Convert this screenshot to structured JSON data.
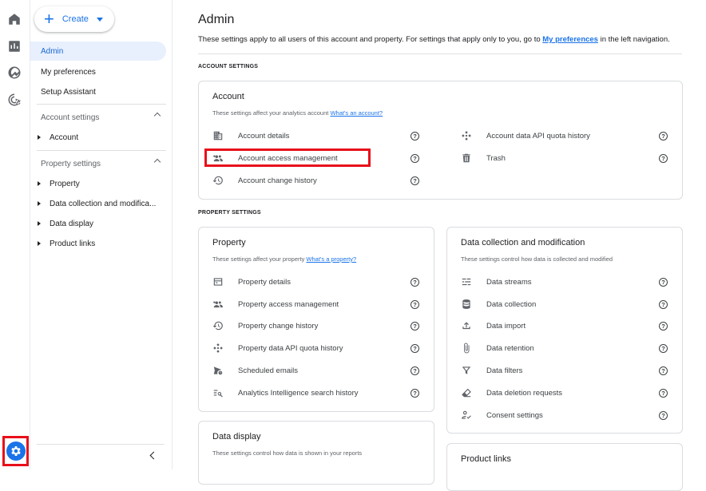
{
  "rail": {
    "icons": [
      "home-icon",
      "reports-icon",
      "explore-icon",
      "advertising-icon"
    ],
    "admin_icon": "gear-icon"
  },
  "nav": {
    "create_label": "Create",
    "items": {
      "admin": "Admin",
      "preferences": "My preferences",
      "setup": "Setup Assistant"
    },
    "account_settings": {
      "label": "Account settings",
      "items": [
        "Account"
      ]
    },
    "property_settings": {
      "label": "Property settings",
      "items": [
        "Property",
        "Data collection and modifica...",
        "Data display",
        "Product links"
      ]
    }
  },
  "main": {
    "title": "Admin",
    "subtitle_before": "These settings apply to all users of this account and property. For settings that apply only to you, go to ",
    "subtitle_link": "My preferences",
    "subtitle_after": " in the left navigation.",
    "account_section_label": "ACCOUNT SETTINGS",
    "property_section_label": "PROPERTY SETTINGS"
  },
  "account_card": {
    "title": "Account",
    "subtitle": "These settings affect your analytics account ",
    "subtitle_link": "What's an account?",
    "left_items": [
      "Account details",
      "Account access management",
      "Account change history"
    ],
    "right_items": [
      "Account data API quota history",
      "Trash"
    ]
  },
  "property_card": {
    "title": "Property",
    "subtitle": "These settings affect your property ",
    "subtitle_link": "What's a property?",
    "items": [
      "Property details",
      "Property access management",
      "Property change history",
      "Property data API quota history",
      "Scheduled emails",
      "Analytics Intelligence search history"
    ]
  },
  "data_collection_card": {
    "title": "Data collection and modification",
    "subtitle": "These settings control how data is collected and modified",
    "items": [
      "Data streams",
      "Data collection",
      "Data import",
      "Data retention",
      "Data filters",
      "Data deletion requests",
      "Consent settings"
    ]
  },
  "data_display_card": {
    "title": "Data display",
    "subtitle": "These settings control how data is shown in your reports"
  },
  "product_links_card": {
    "title": "Product links"
  },
  "help_glyph": "?"
}
